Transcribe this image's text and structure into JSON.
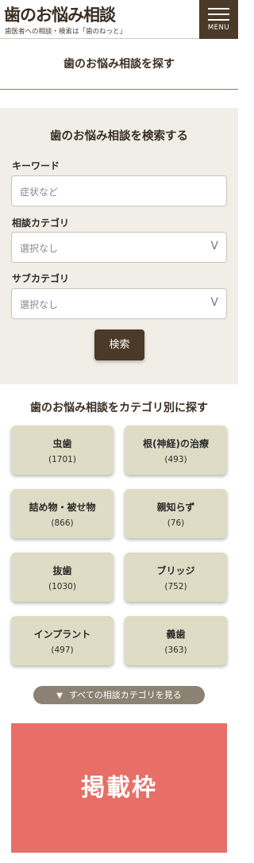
{
  "header": {
    "logo": "歯のお悩み相談",
    "tagline": "歯医者への相談・検索は「歯のねっと」",
    "menu_label": "MENU"
  },
  "page": {
    "title": "歯のお悩み相談を探す"
  },
  "search": {
    "title": "歯のお悩み相談を検索する",
    "keyword_label": "キーワード",
    "keyword_placeholder": "症状など",
    "category_label": "相談カテゴリ",
    "category_value": "選択なし",
    "subcategory_label": "サブカテゴリ",
    "subcategory_value": "選択なし",
    "chevron": "V",
    "submit_label": "検索"
  },
  "categories": {
    "title": "歯のお悩み相談をカテゴリ別に探す",
    "items": [
      {
        "name": "虫歯",
        "count": "(1701)"
      },
      {
        "name": "根(神経)の治療",
        "count": "(493)"
      },
      {
        "name": "詰め物・被せ物",
        "count": "(866)"
      },
      {
        "name": "親知らず",
        "count": "(76)"
      },
      {
        "name": "抜歯",
        "count": "(1030)"
      },
      {
        "name": "ブリッジ",
        "count": "(752)"
      },
      {
        "name": "インプラント",
        "count": "(497)"
      },
      {
        "name": "義歯",
        "count": "(363)"
      }
    ],
    "all_arrow": "▼",
    "all_label": "すべての相談カテゴリを見る"
  },
  "ad": {
    "label": "掲載枠"
  },
  "colors": {
    "brand_brown": "#4b3a27",
    "panel_beige": "#f1eee7",
    "card_beige": "#dfdcc5",
    "ad_red": "#e76f67"
  }
}
